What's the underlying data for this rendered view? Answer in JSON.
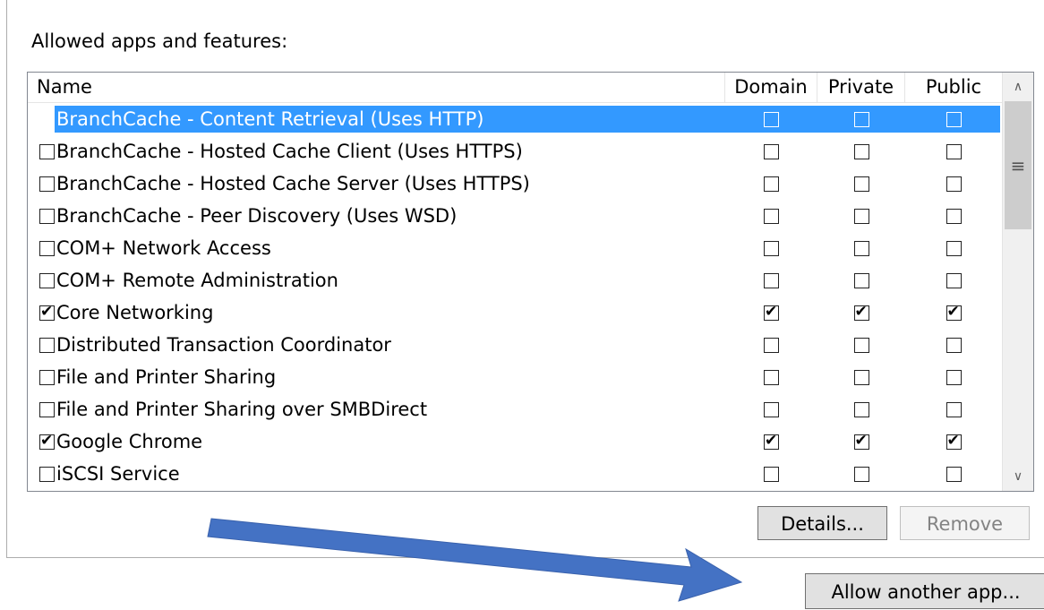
{
  "group_label": "Allowed apps and features:",
  "columns": {
    "name": "Name",
    "domain": "Domain",
    "private": "Private",
    "public": "Public"
  },
  "rows": [
    {
      "name": "BranchCache - Content Retrieval (Uses HTTP)",
      "enabled": false,
      "domain": false,
      "private": false,
      "public": false,
      "selected": true
    },
    {
      "name": "BranchCache - Hosted Cache Client (Uses HTTPS)",
      "enabled": false,
      "domain": false,
      "private": false,
      "public": false
    },
    {
      "name": "BranchCache - Hosted Cache Server (Uses HTTPS)",
      "enabled": false,
      "domain": false,
      "private": false,
      "public": false
    },
    {
      "name": "BranchCache - Peer Discovery (Uses WSD)",
      "enabled": false,
      "domain": false,
      "private": false,
      "public": false
    },
    {
      "name": "COM+ Network Access",
      "enabled": false,
      "domain": false,
      "private": false,
      "public": false
    },
    {
      "name": "COM+ Remote Administration",
      "enabled": false,
      "domain": false,
      "private": false,
      "public": false
    },
    {
      "name": "Core Networking",
      "enabled": true,
      "domain": true,
      "private": true,
      "public": true
    },
    {
      "name": "Distributed Transaction Coordinator",
      "enabled": false,
      "domain": false,
      "private": false,
      "public": false
    },
    {
      "name": "File and Printer Sharing",
      "enabled": false,
      "domain": false,
      "private": false,
      "public": false
    },
    {
      "name": "File and Printer Sharing over SMBDirect",
      "enabled": false,
      "domain": false,
      "private": false,
      "public": false
    },
    {
      "name": "Google Chrome",
      "enabled": true,
      "domain": true,
      "private": true,
      "public": true
    },
    {
      "name": "iSCSI Service",
      "enabled": false,
      "domain": false,
      "private": false,
      "public": false
    }
  ],
  "buttons": {
    "details": "Details...",
    "remove": "Remove",
    "allow_another": "Allow another app..."
  },
  "icons": {
    "scroll_up": "chevron-up-icon",
    "scroll_down": "chevron-down-icon",
    "thumb_grip": "grip-lines-icon"
  },
  "colors": {
    "selection": "#3399ff",
    "arrow": "#4472c4"
  }
}
